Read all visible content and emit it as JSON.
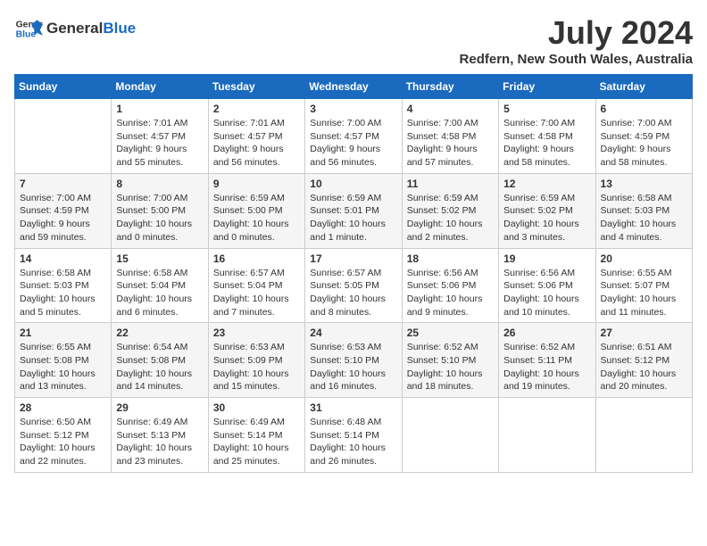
{
  "logo": {
    "general": "General",
    "blue": "Blue"
  },
  "title": {
    "month_year": "July 2024",
    "location": "Redfern, New South Wales, Australia"
  },
  "headers": [
    "Sunday",
    "Monday",
    "Tuesday",
    "Wednesday",
    "Thursday",
    "Friday",
    "Saturday"
  ],
  "weeks": [
    [
      {
        "day": "",
        "sunrise": "",
        "sunset": "",
        "daylight": ""
      },
      {
        "day": "1",
        "sunrise": "Sunrise: 7:01 AM",
        "sunset": "Sunset: 4:57 PM",
        "daylight": "Daylight: 9 hours and 55 minutes."
      },
      {
        "day": "2",
        "sunrise": "Sunrise: 7:01 AM",
        "sunset": "Sunset: 4:57 PM",
        "daylight": "Daylight: 9 hours and 56 minutes."
      },
      {
        "day": "3",
        "sunrise": "Sunrise: 7:00 AM",
        "sunset": "Sunset: 4:57 PM",
        "daylight": "Daylight: 9 hours and 56 minutes."
      },
      {
        "day": "4",
        "sunrise": "Sunrise: 7:00 AM",
        "sunset": "Sunset: 4:58 PM",
        "daylight": "Daylight: 9 hours and 57 minutes."
      },
      {
        "day": "5",
        "sunrise": "Sunrise: 7:00 AM",
        "sunset": "Sunset: 4:58 PM",
        "daylight": "Daylight: 9 hours and 58 minutes."
      },
      {
        "day": "6",
        "sunrise": "Sunrise: 7:00 AM",
        "sunset": "Sunset: 4:59 PM",
        "daylight": "Daylight: 9 hours and 58 minutes."
      }
    ],
    [
      {
        "day": "7",
        "sunrise": "Sunrise: 7:00 AM",
        "sunset": "Sunset: 4:59 PM",
        "daylight": "Daylight: 9 hours and 59 minutes."
      },
      {
        "day": "8",
        "sunrise": "Sunrise: 7:00 AM",
        "sunset": "Sunset: 5:00 PM",
        "daylight": "Daylight: 10 hours and 0 minutes."
      },
      {
        "day": "9",
        "sunrise": "Sunrise: 6:59 AM",
        "sunset": "Sunset: 5:00 PM",
        "daylight": "Daylight: 10 hours and 0 minutes."
      },
      {
        "day": "10",
        "sunrise": "Sunrise: 6:59 AM",
        "sunset": "Sunset: 5:01 PM",
        "daylight": "Daylight: 10 hours and 1 minute."
      },
      {
        "day": "11",
        "sunrise": "Sunrise: 6:59 AM",
        "sunset": "Sunset: 5:02 PM",
        "daylight": "Daylight: 10 hours and 2 minutes."
      },
      {
        "day": "12",
        "sunrise": "Sunrise: 6:59 AM",
        "sunset": "Sunset: 5:02 PM",
        "daylight": "Daylight: 10 hours and 3 minutes."
      },
      {
        "day": "13",
        "sunrise": "Sunrise: 6:58 AM",
        "sunset": "Sunset: 5:03 PM",
        "daylight": "Daylight: 10 hours and 4 minutes."
      }
    ],
    [
      {
        "day": "14",
        "sunrise": "Sunrise: 6:58 AM",
        "sunset": "Sunset: 5:03 PM",
        "daylight": "Daylight: 10 hours and 5 minutes."
      },
      {
        "day": "15",
        "sunrise": "Sunrise: 6:58 AM",
        "sunset": "Sunset: 5:04 PM",
        "daylight": "Daylight: 10 hours and 6 minutes."
      },
      {
        "day": "16",
        "sunrise": "Sunrise: 6:57 AM",
        "sunset": "Sunset: 5:04 PM",
        "daylight": "Daylight: 10 hours and 7 minutes."
      },
      {
        "day": "17",
        "sunrise": "Sunrise: 6:57 AM",
        "sunset": "Sunset: 5:05 PM",
        "daylight": "Daylight: 10 hours and 8 minutes."
      },
      {
        "day": "18",
        "sunrise": "Sunrise: 6:56 AM",
        "sunset": "Sunset: 5:06 PM",
        "daylight": "Daylight: 10 hours and 9 minutes."
      },
      {
        "day": "19",
        "sunrise": "Sunrise: 6:56 AM",
        "sunset": "Sunset: 5:06 PM",
        "daylight": "Daylight: 10 hours and 10 minutes."
      },
      {
        "day": "20",
        "sunrise": "Sunrise: 6:55 AM",
        "sunset": "Sunset: 5:07 PM",
        "daylight": "Daylight: 10 hours and 11 minutes."
      }
    ],
    [
      {
        "day": "21",
        "sunrise": "Sunrise: 6:55 AM",
        "sunset": "Sunset: 5:08 PM",
        "daylight": "Daylight: 10 hours and 13 minutes."
      },
      {
        "day": "22",
        "sunrise": "Sunrise: 6:54 AM",
        "sunset": "Sunset: 5:08 PM",
        "daylight": "Daylight: 10 hours and 14 minutes."
      },
      {
        "day": "23",
        "sunrise": "Sunrise: 6:53 AM",
        "sunset": "Sunset: 5:09 PM",
        "daylight": "Daylight: 10 hours and 15 minutes."
      },
      {
        "day": "24",
        "sunrise": "Sunrise: 6:53 AM",
        "sunset": "Sunset: 5:10 PM",
        "daylight": "Daylight: 10 hours and 16 minutes."
      },
      {
        "day": "25",
        "sunrise": "Sunrise: 6:52 AM",
        "sunset": "Sunset: 5:10 PM",
        "daylight": "Daylight: 10 hours and 18 minutes."
      },
      {
        "day": "26",
        "sunrise": "Sunrise: 6:52 AM",
        "sunset": "Sunset: 5:11 PM",
        "daylight": "Daylight: 10 hours and 19 minutes."
      },
      {
        "day": "27",
        "sunrise": "Sunrise: 6:51 AM",
        "sunset": "Sunset: 5:12 PM",
        "daylight": "Daylight: 10 hours and 20 minutes."
      }
    ],
    [
      {
        "day": "28",
        "sunrise": "Sunrise: 6:50 AM",
        "sunset": "Sunset: 5:12 PM",
        "daylight": "Daylight: 10 hours and 22 minutes."
      },
      {
        "day": "29",
        "sunrise": "Sunrise: 6:49 AM",
        "sunset": "Sunset: 5:13 PM",
        "daylight": "Daylight: 10 hours and 23 minutes."
      },
      {
        "day": "30",
        "sunrise": "Sunrise: 6:49 AM",
        "sunset": "Sunset: 5:14 PM",
        "daylight": "Daylight: 10 hours and 25 minutes."
      },
      {
        "day": "31",
        "sunrise": "Sunrise: 6:48 AM",
        "sunset": "Sunset: 5:14 PM",
        "daylight": "Daylight: 10 hours and 26 minutes."
      },
      {
        "day": "",
        "sunrise": "",
        "sunset": "",
        "daylight": ""
      },
      {
        "day": "",
        "sunrise": "",
        "sunset": "",
        "daylight": ""
      },
      {
        "day": "",
        "sunrise": "",
        "sunset": "",
        "daylight": ""
      }
    ]
  ]
}
